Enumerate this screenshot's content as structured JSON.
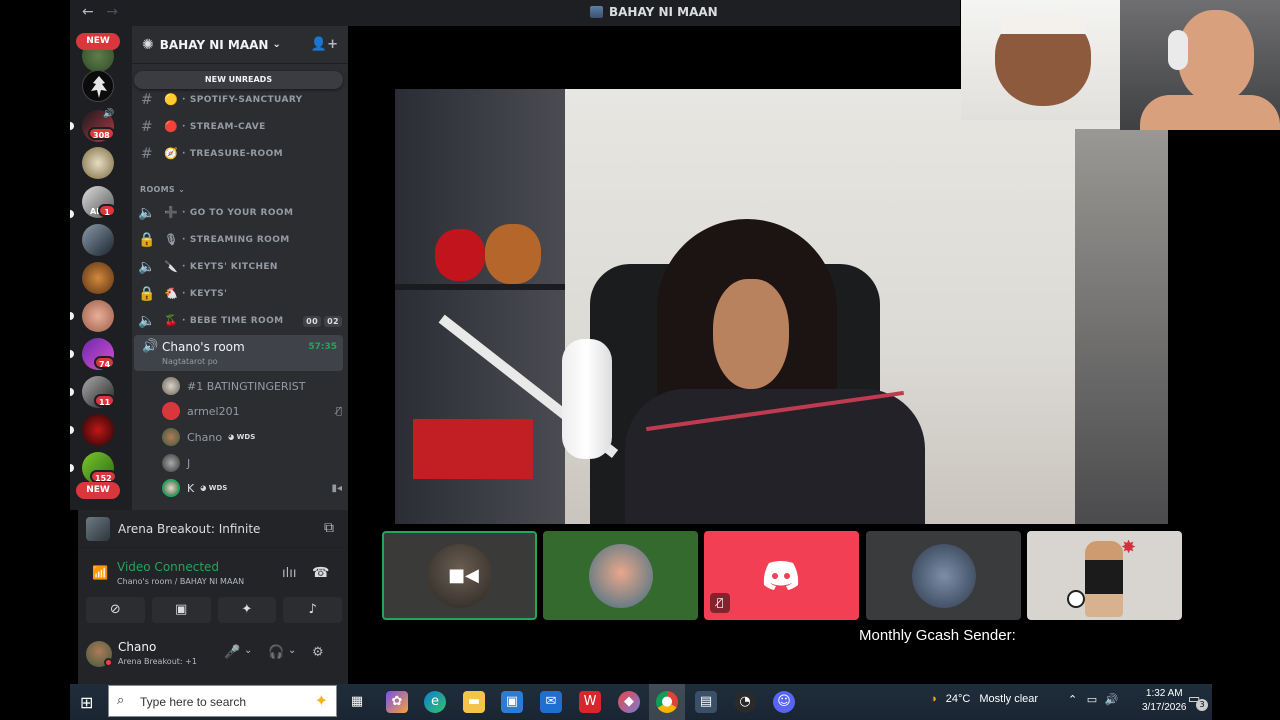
{
  "window": {
    "title": "BAHAY NI MAAN",
    "back_glyph": "←",
    "forward_glyph": "→"
  },
  "server_rail": {
    "new_badge_top": "NEW",
    "new_badge_bottom": "NEW",
    "counts": [
      "308",
      "1",
      "74",
      "11",
      "152"
    ],
    "icon_caption": "AL"
  },
  "server": {
    "name": "BAHAY NI MAAN",
    "new_unreads": "NEW UNREADS"
  },
  "channels": {
    "text": [
      {
        "name": "SPOTIFY-SANCTUARY",
        "emoji": "🟡"
      },
      {
        "name": "STREAM-CAVE",
        "emoji": "🔴"
      },
      {
        "name": "TREASURE-ROOM",
        "emoji": "🧭"
      }
    ],
    "category": "ROOMS",
    "voice": [
      {
        "name": "GO TO YOUR ROOM",
        "emoji": "➕",
        "icon": "speaker-icon"
      },
      {
        "name": "STREAMING ROOM",
        "emoji": "🎙",
        "icon": "lock-icon"
      },
      {
        "name": "KEYTS' KITCHEN",
        "emoji": "🔪",
        "icon": "speaker-icon"
      },
      {
        "name": "KEYTS'",
        "emoji": "🐔",
        "icon": "lock-icon"
      },
      {
        "name": "BEBE TIME ROOM",
        "emoji": "🍒",
        "icon": "speaker-icon",
        "timer": [
          "00",
          "02"
        ]
      }
    ]
  },
  "active_room": {
    "name": "Chano's room",
    "status": "Nagtatarot po",
    "elapsed": "57:35"
  },
  "members": [
    {
      "name": "#1 BATINGTINGERIST",
      "tag": ""
    },
    {
      "name": "armel201",
      "tag": ""
    },
    {
      "name": "Chano",
      "tag": "WDS"
    },
    {
      "name": "J",
      "tag": ""
    },
    {
      "name": "K",
      "tag": "WDS"
    }
  ],
  "activity": {
    "game": "Arena Breakout: Infinite"
  },
  "voice_status": {
    "status": "Video Connected",
    "location": "Chano's room / BAHAY NI MAAN"
  },
  "profile": {
    "name": "Chano",
    "activity": "Arena Breakout: +1"
  },
  "overlay": {
    "text": "Monthly Gcash Sender:"
  },
  "taskbar": {
    "search_placeholder": "Type here to search",
    "weather_temp": "24°C",
    "weather_text": "Mostly clear",
    "time": "1:32 AM",
    "date": "3/17/2026",
    "notifications": "3"
  },
  "colors": {
    "accent_green": "#23a55a",
    "danger_red": "#da373c",
    "discord_blurple_tile": "#f23f53",
    "sidebar_bg": "#2b2d31",
    "rail_bg": "#1e1f22"
  }
}
